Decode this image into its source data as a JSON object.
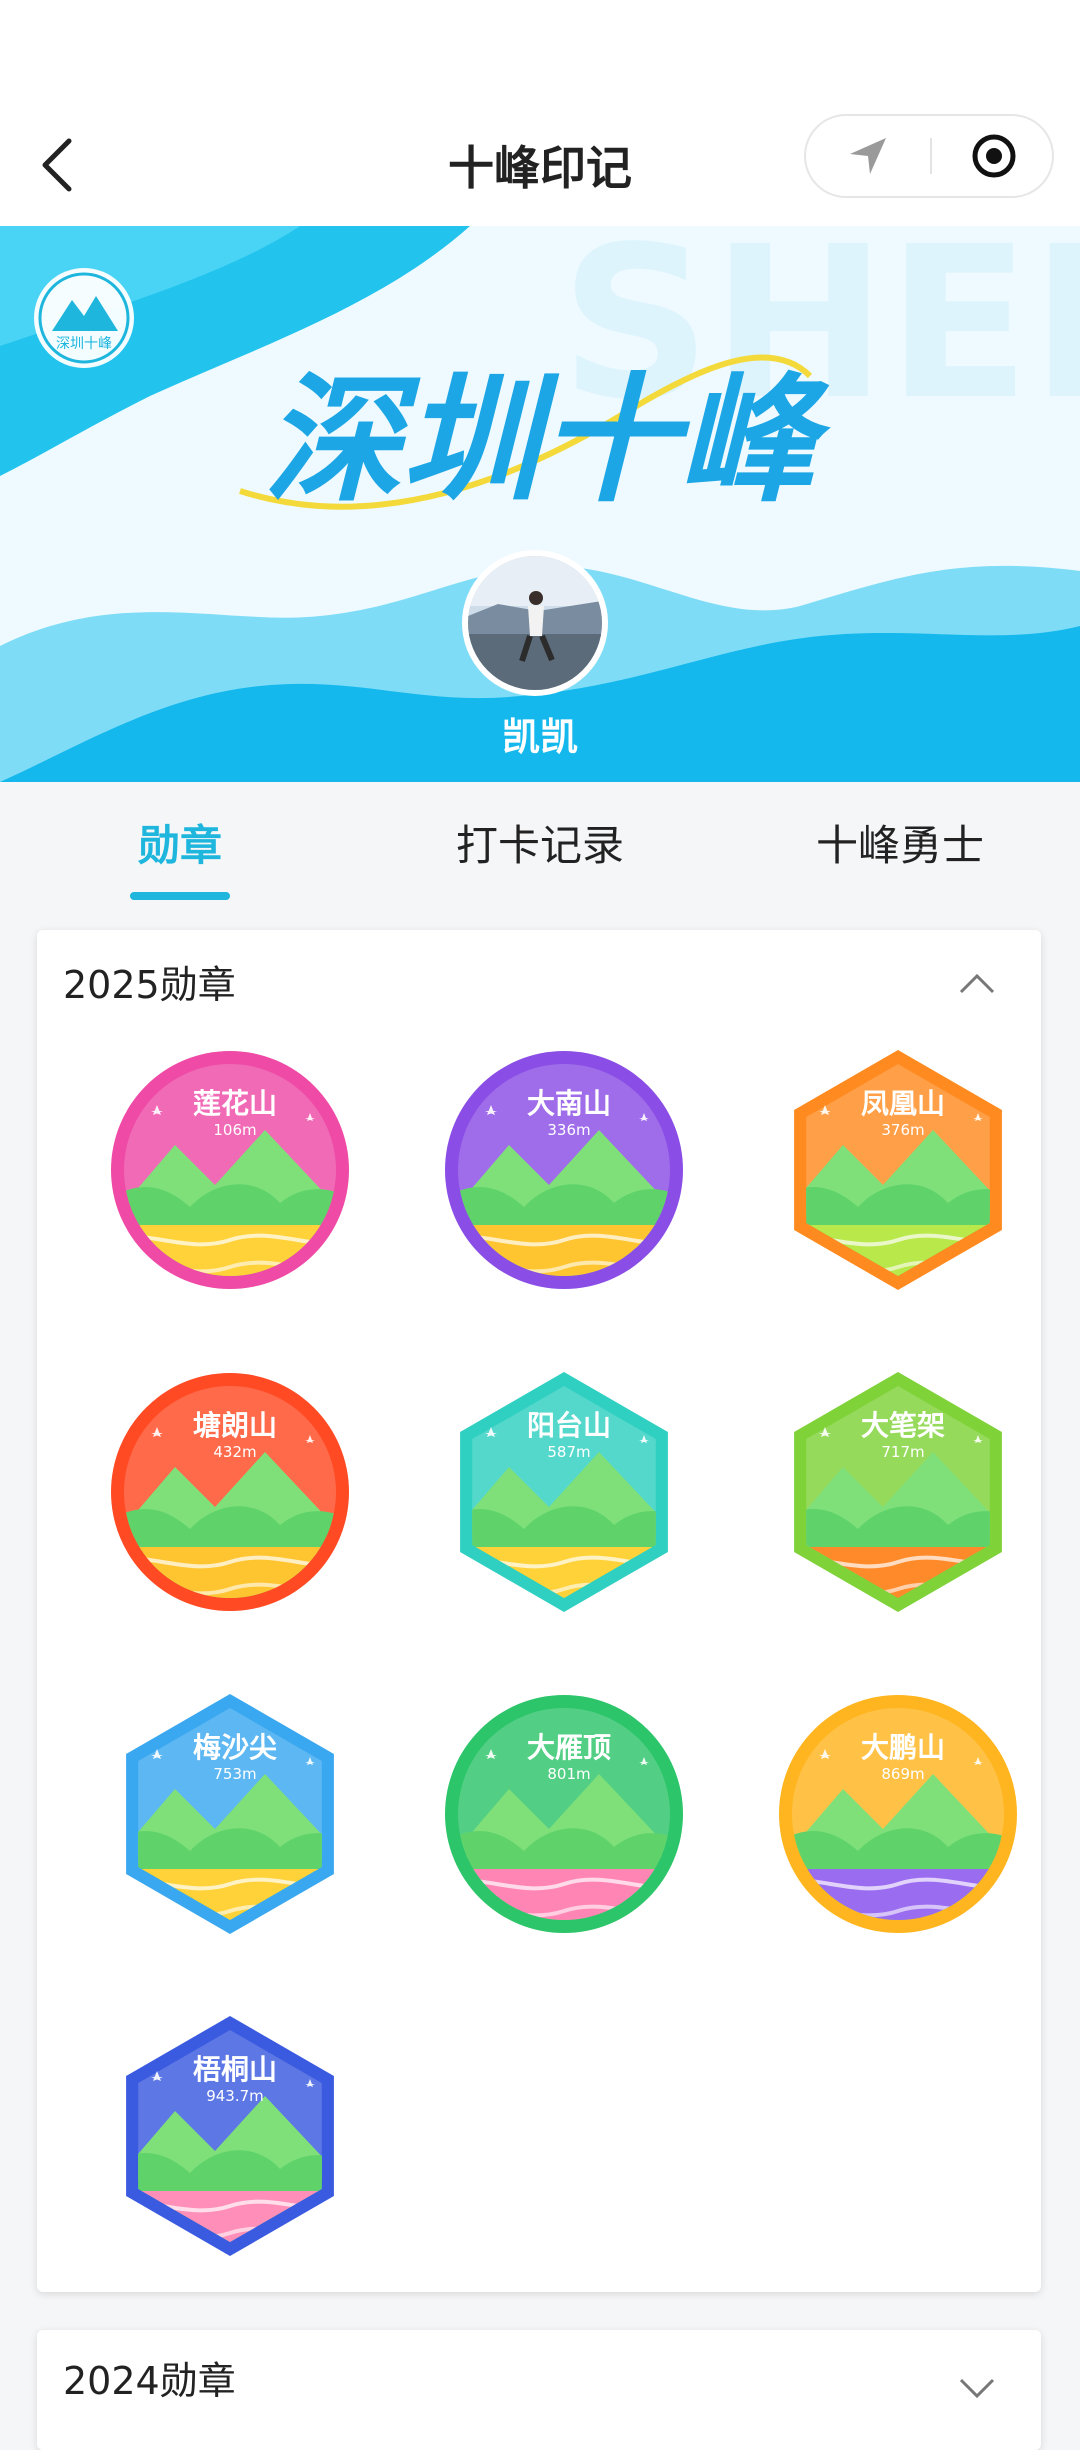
{
  "nav": {
    "title": "十峰印记"
  },
  "banner": {
    "title": "深圳十峰",
    "bg_text": "SHENZHEN SHIFENG",
    "logo_text": "深圳十峰",
    "nickname": "凯凯"
  },
  "tabs": [
    {
      "label": "勋章",
      "active": true
    },
    {
      "label": "打卡记录",
      "active": false
    },
    {
      "label": "十峰勇士",
      "active": false
    }
  ],
  "sections": [
    {
      "title": "2025勋章",
      "expanded": true,
      "badges": [
        {
          "name": "莲花山",
          "alt": "106m",
          "shape": "circle",
          "color": "#ee4aa6",
          "accent": "#ffd23a"
        },
        {
          "name": "大南山",
          "alt": "336m",
          "shape": "circle",
          "color": "#8a4de6",
          "accent": "#ffc531"
        },
        {
          "name": "凤凰山",
          "alt": "376m",
          "shape": "hex",
          "color": "#ff8a1f",
          "accent": "#b8e84a"
        },
        {
          "name": "塘朗山",
          "alt": "432m",
          "shape": "circle",
          "color": "#ff4a24",
          "accent": "#ffc531"
        },
        {
          "name": "阳台山",
          "alt": "587m",
          "shape": "hex",
          "color": "#2fd0c1",
          "accent": "#ffd23a"
        },
        {
          "name": "大笔架",
          "alt": "717m",
          "shape": "hex",
          "color": "#7fd238",
          "accent": "#ff8a2a"
        },
        {
          "name": "梅沙尖",
          "alt": "753m",
          "shape": "hex",
          "color": "#3aa8f0",
          "accent": "#ffd23a"
        },
        {
          "name": "大雁顶",
          "alt": "801m",
          "shape": "circle",
          "color": "#2cc56a",
          "accent": "#ff85b5"
        },
        {
          "name": "大鹏山",
          "alt": "869m",
          "shape": "circle",
          "color": "#ffb51f",
          "accent": "#9a6cf0"
        },
        {
          "name": "梧桐山",
          "alt": "943.7m",
          "shape": "hex",
          "color": "#3a5ae0",
          "accent": "#ff8fb8"
        }
      ]
    },
    {
      "title": "2024勋章",
      "expanded": false,
      "badges": []
    }
  ]
}
